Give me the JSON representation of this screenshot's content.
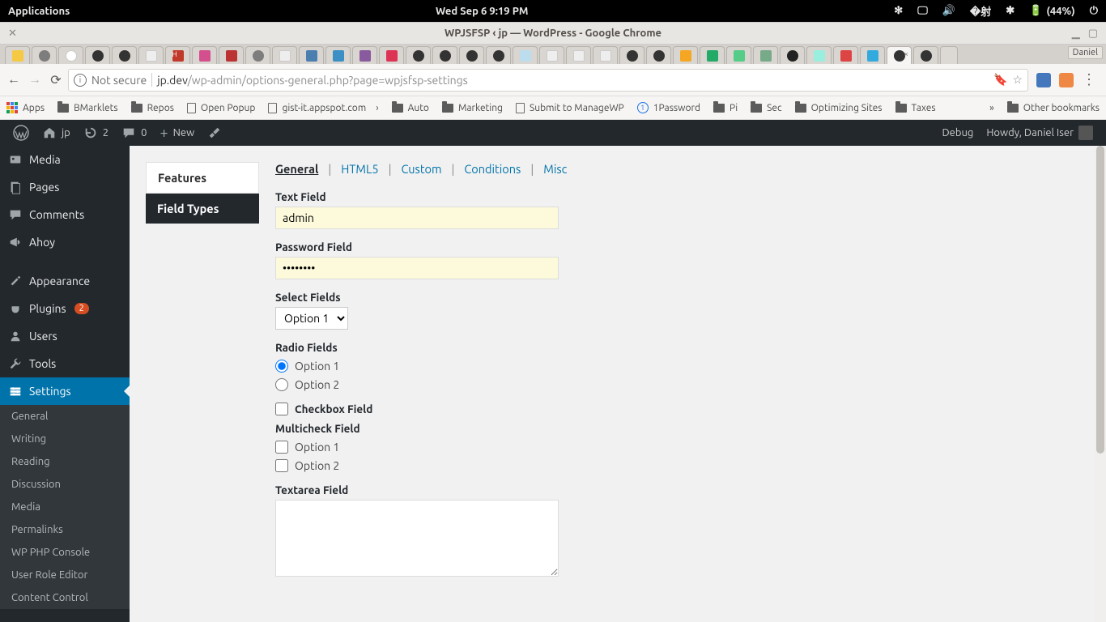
{
  "gnome": {
    "apps_label": "Applications",
    "clock": "Wed Sep  6   9:19 PM",
    "battery": "(44%)"
  },
  "window": {
    "title": "WPJSFSP ‹ jp — WordPress - Google Chrome",
    "profile_badge": "Daniel"
  },
  "omnibox": {
    "not_secure": "Not secure",
    "host": "jp.dev",
    "path": "/wp-admin/options-general.php?page=wpjsfsp-settings"
  },
  "bookmarks": {
    "apps": "Apps",
    "items": [
      "BMarklets",
      "Repos",
      "Open Popup",
      "gist-it.appspot.com",
      "Auto",
      "Marketing",
      "Submit to ManageWP",
      "1Password",
      "Pi",
      "Sec",
      "Optimizing Sites",
      "Taxes"
    ],
    "other": "Other bookmarks"
  },
  "wp_admin_bar": {
    "site": "jp",
    "updates": "2",
    "comments": "0",
    "new": "New",
    "debug": "Debug",
    "howdy": "Howdy, Daniel Iser"
  },
  "wp_sidebar": {
    "media": "Media",
    "pages": "Pages",
    "comments": "Comments",
    "ahoy": "Ahoy",
    "appearance": "Appearance",
    "plugins": "Plugins",
    "plugins_count": "2",
    "users": "Users",
    "tools": "Tools",
    "settings": "Settings",
    "sub": [
      "General",
      "Writing",
      "Reading",
      "Discussion",
      "Media",
      "Permalinks",
      "WP PHP Console",
      "User Role Editor",
      "Content Control"
    ]
  },
  "side_tabs": {
    "features": "Features",
    "field_types": "Field Types"
  },
  "form_tabs": [
    "General",
    "HTML5",
    "Custom",
    "Conditions",
    "Misc"
  ],
  "form": {
    "text_label": "Text Field",
    "text_value": "admin",
    "password_label": "Password Field",
    "password_value": "••••••••",
    "select_label": "Select Fields",
    "select_value": "Option 1",
    "radio_label": "Radio Fields",
    "radio_opts": [
      "Option 1",
      "Option 2"
    ],
    "checkbox_label": "Checkbox Field",
    "multi_label": "Multicheck Field",
    "multi_opts": [
      "Option 1",
      "Option 2"
    ],
    "textarea_label": "Textarea Field"
  }
}
